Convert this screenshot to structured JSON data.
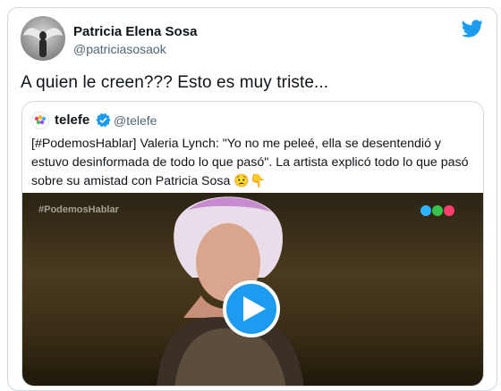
{
  "author": {
    "display_name": "Patricia Elena Sosa",
    "handle": "@patriciasosaok"
  },
  "tweet": {
    "text": "A quien le creen??? Esto es muy triste..."
  },
  "quoted": {
    "display_name": "telefe",
    "handle": "@telefe",
    "text": "[#PodemosHablar] Valeria Lynch: \"Yo no me peleé, ella se desentendió y estuvo desinformada de todo lo que pasó\". La artista explicó todo lo que pasó sobre su amistad con Patricia Sosa 😟👇",
    "media": {
      "overlay_text": "#PodemosHablar"
    }
  },
  "icons": {
    "brand": "twitter-bird-icon",
    "verified": "verified-badge-icon",
    "play": "play-icon",
    "channel_logo": "telefe-dots-logo"
  },
  "colors": {
    "accent": "#1d9bf0",
    "secondary_text": "#536471",
    "border": "#cfd9de"
  }
}
